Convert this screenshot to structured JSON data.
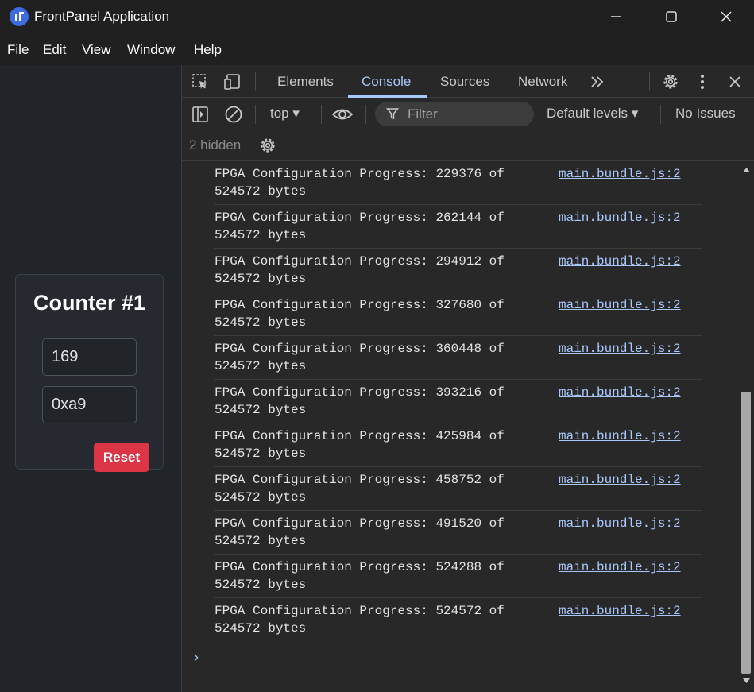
{
  "window": {
    "title": "FrontPanel Application"
  },
  "menu": [
    "File",
    "Edit",
    "View",
    "Window",
    "Help"
  ],
  "counter": {
    "title": "Counter #1",
    "decimal_value": "169",
    "hex_value": "0xa9",
    "reset_label": "Reset"
  },
  "devtools": {
    "tabs": [
      "Elements",
      "Console",
      "Sources",
      "Network"
    ],
    "active_tab": "Console",
    "context": "top",
    "filter_placeholder": "Filter",
    "levels": "Default levels",
    "issues": "No Issues",
    "hidden_count": "2 hidden"
  },
  "console": {
    "logs": [
      {
        "line1": "FPGA Configuration Progress: 229376 of",
        "line2": "524572 bytes",
        "source": "main.bundle.js:2"
      },
      {
        "line1": "FPGA Configuration Progress: 262144 of",
        "line2": "524572 bytes",
        "source": "main.bundle.js:2"
      },
      {
        "line1": "FPGA Configuration Progress: 294912 of",
        "line2": "524572 bytes",
        "source": "main.bundle.js:2"
      },
      {
        "line1": "FPGA Configuration Progress: 327680 of",
        "line2": "524572 bytes",
        "source": "main.bundle.js:2"
      },
      {
        "line1": "FPGA Configuration Progress: 360448 of",
        "line2": "524572 bytes",
        "source": "main.bundle.js:2"
      },
      {
        "line1": "FPGA Configuration Progress: 393216 of",
        "line2": "524572 bytes",
        "source": "main.bundle.js:2"
      },
      {
        "line1": "FPGA Configuration Progress: 425984 of",
        "line2": "524572 bytes",
        "source": "main.bundle.js:2"
      },
      {
        "line1": "FPGA Configuration Progress: 458752 of",
        "line2": "524572 bytes",
        "source": "main.bundle.js:2"
      },
      {
        "line1": "FPGA Configuration Progress: 491520 of",
        "line2": "524572 bytes",
        "source": "main.bundle.js:2"
      },
      {
        "line1": "FPGA Configuration Progress: 524288 of",
        "line2": "524572 bytes",
        "source": "main.bundle.js:2"
      },
      {
        "line1": "FPGA Configuration Progress: 524572 of",
        "line2": "524572 bytes",
        "source": "main.bundle.js:2"
      }
    ]
  },
  "icons": {
    "app": "frontpanel-logo-icon",
    "minimize": "minimize-icon",
    "maximize": "maximize-icon",
    "close": "close-icon",
    "inspect": "inspect-element-icon",
    "device": "device-toolbar-icon",
    "more_tabs": "more-tabs-icon",
    "settings": "settings-gear-icon",
    "kebab": "more-options-icon",
    "dt_close": "close-devtools-icon",
    "sidebar": "show-sidebar-icon",
    "clear": "clear-console-icon",
    "eye": "live-expression-icon",
    "filter": "filter-icon",
    "hidden_settings": "console-settings-icon",
    "prompt": "console-prompt-icon"
  },
  "colors": {
    "accent": "#a8c7fa",
    "reset": "#dc3545",
    "app_icon": "#3d6be0"
  }
}
